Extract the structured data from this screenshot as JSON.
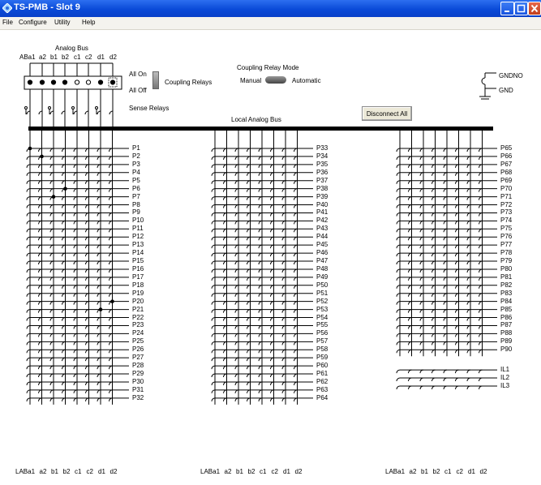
{
  "window": {
    "title": "TS-PMB - Slot 9"
  },
  "menu": {
    "items": [
      "File",
      "Configure",
      "Utility",
      "Help"
    ]
  },
  "analog_bus": {
    "title": "Analog Bus",
    "lines": [
      "ABa1",
      "a2",
      "b1",
      "b2",
      "c1",
      "c2",
      "d1",
      "d2"
    ],
    "coupling_states": [
      "on",
      "on",
      "on",
      "on",
      "off",
      "off",
      "on",
      "on-selected"
    ]
  },
  "coupling": {
    "all_on": "All On",
    "all_off": "All Off",
    "label": "Coupling Relays"
  },
  "relay_mode": {
    "title": "Coupling Relay Mode",
    "manual": "Manual",
    "automatic": "Automatic"
  },
  "disconnect_label": "Disconnect All",
  "sense_relays": "Sense Relays",
  "local_bus": "Local Analog Bus",
  "ground": {
    "gndno": "GNDNO",
    "gnd": "GND"
  },
  "bottom_labels": [
    "LABa1",
    "a2",
    "b1",
    "b2",
    "c1",
    "c2",
    "d1",
    "d2"
  ],
  "blocks": [
    {
      "pins": [
        "P1",
        "P2",
        "P3",
        "P4",
        "P5",
        "P6",
        "P7",
        "P8",
        "P9",
        "P10",
        "P11",
        "P12",
        "P13",
        "P14",
        "P15",
        "P16",
        "P17",
        "P18",
        "P19",
        "P20",
        "P21",
        "P22",
        "P23",
        "P24",
        "P25",
        "P26",
        "P27",
        "P28",
        "P29",
        "P30",
        "P31",
        "P32"
      ],
      "closed": [
        {
          "pin": "P1",
          "col": 0
        },
        {
          "pin": "P2",
          "col": 1
        },
        {
          "pin": "P6",
          "col": 3
        },
        {
          "pin": "P7",
          "col": 2
        },
        {
          "pin": "P20",
          "col": 7
        },
        {
          "pin": "P21",
          "col": 6
        }
      ]
    },
    {
      "pins": [
        "P33",
        "P34",
        "P35",
        "P36",
        "P37",
        "P38",
        "P39",
        "P40",
        "P41",
        "P42",
        "P43",
        "P44",
        "P45",
        "P46",
        "P47",
        "P48",
        "P49",
        "P50",
        "P51",
        "P52",
        "P53",
        "P54",
        "P55",
        "P56",
        "P57",
        "P58",
        "P59",
        "P60",
        "P61",
        "P62",
        "P63",
        "P64"
      ],
      "closed": []
    },
    {
      "pins": [
        "P65",
        "P66",
        "P67",
        "P68",
        "P69",
        "P70",
        "P71",
        "P72",
        "P73",
        "P74",
        "P75",
        "P76",
        "P77",
        "P78",
        "P79",
        "P80",
        "P81",
        "P82",
        "P83",
        "P84",
        "P85",
        "P86",
        "P87",
        "P88",
        "P89",
        "P90"
      ],
      "extra": [
        "IL1",
        "IL2",
        "IL3"
      ],
      "closed": []
    }
  ]
}
